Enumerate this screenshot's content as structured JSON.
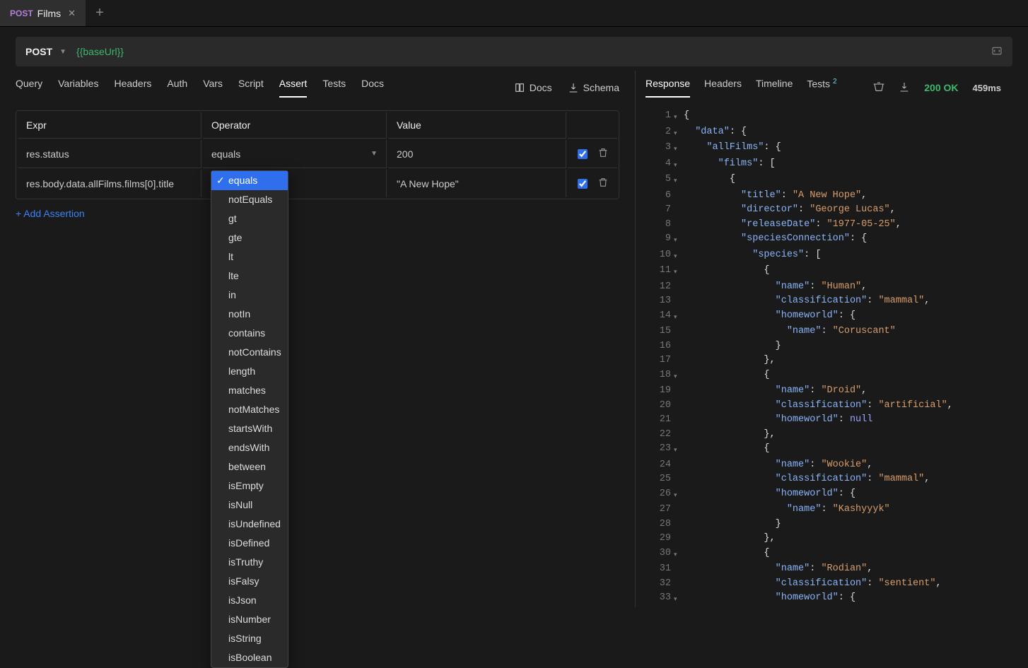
{
  "tab": {
    "method": "POST",
    "title": "Films"
  },
  "request": {
    "method": "POST",
    "url": "{{baseUrl}}"
  },
  "left_tabs": [
    "Query",
    "Variables",
    "Headers",
    "Auth",
    "Vars",
    "Script",
    "Assert",
    "Tests",
    "Docs"
  ],
  "left_tabs_active": "Assert",
  "left_right_links": {
    "docs": "Docs",
    "schema": "Schema"
  },
  "cols": {
    "expr": "Expr",
    "operator": "Operator",
    "value": "Value"
  },
  "assertions": [
    {
      "expr": "res.status",
      "operator": "equals",
      "value": "200",
      "enabled": true
    },
    {
      "expr": "res.body.data.allFilms.films[0].title",
      "operator": "equals",
      "value": "\"A New Hope\"",
      "enabled": true
    }
  ],
  "operator_options": [
    "equals",
    "notEquals",
    "gt",
    "gte",
    "lt",
    "lte",
    "in",
    "notIn",
    "contains",
    "notContains",
    "length",
    "matches",
    "notMatches",
    "startsWith",
    "endsWith",
    "between",
    "isEmpty",
    "isNull",
    "isUndefined",
    "isDefined",
    "isTruthy",
    "isFalsy",
    "isJson",
    "isNumber",
    "isString",
    "isBoolean"
  ],
  "operator_selected": "equals",
  "add_assertion_label": "+ Add Assertion",
  "resp_tabs": {
    "response": "Response",
    "headers": "Headers",
    "timeline": "Timeline",
    "tests": "Tests",
    "tests_count": "2"
  },
  "resp_tabs_active": "Response",
  "status": {
    "code": "200 OK",
    "time": "459ms",
    "size": ""
  },
  "json_lines": [
    {
      "n": 1,
      "f": true,
      "tokens": [
        [
          "brace",
          "{"
        ]
      ]
    },
    {
      "n": 2,
      "f": true,
      "tokens": [
        [
          "sp",
          "  "
        ],
        [
          "key",
          "\"data\""
        ],
        [
          "brace",
          ": {"
        ]
      ]
    },
    {
      "n": 3,
      "f": true,
      "tokens": [
        [
          "sp",
          "    "
        ],
        [
          "key",
          "\"allFilms\""
        ],
        [
          "brace",
          ": {"
        ]
      ]
    },
    {
      "n": 4,
      "f": true,
      "tokens": [
        [
          "sp",
          "      "
        ],
        [
          "key",
          "\"films\""
        ],
        [
          "brace",
          ": ["
        ]
      ]
    },
    {
      "n": 5,
      "f": true,
      "tokens": [
        [
          "sp",
          "        "
        ],
        [
          "brace",
          "{"
        ]
      ]
    },
    {
      "n": 6,
      "f": false,
      "tokens": [
        [
          "sp",
          "          "
        ],
        [
          "key",
          "\"title\""
        ],
        [
          "brace",
          ": "
        ],
        [
          "str",
          "\"A New Hope\""
        ],
        [
          "brace",
          ","
        ]
      ]
    },
    {
      "n": 7,
      "f": false,
      "tokens": [
        [
          "sp",
          "          "
        ],
        [
          "key",
          "\"director\""
        ],
        [
          "brace",
          ": "
        ],
        [
          "str",
          "\"George Lucas\""
        ],
        [
          "brace",
          ","
        ]
      ]
    },
    {
      "n": 8,
      "f": false,
      "tokens": [
        [
          "sp",
          "          "
        ],
        [
          "key",
          "\"releaseDate\""
        ],
        [
          "brace",
          ": "
        ],
        [
          "str",
          "\"1977-05-25\""
        ],
        [
          "brace",
          ","
        ]
      ]
    },
    {
      "n": 9,
      "f": true,
      "tokens": [
        [
          "sp",
          "          "
        ],
        [
          "key",
          "\"speciesConnection\""
        ],
        [
          "brace",
          ": {"
        ]
      ]
    },
    {
      "n": 10,
      "f": true,
      "tokens": [
        [
          "sp",
          "            "
        ],
        [
          "key",
          "\"species\""
        ],
        [
          "brace",
          ": ["
        ]
      ]
    },
    {
      "n": 11,
      "f": true,
      "tokens": [
        [
          "sp",
          "              "
        ],
        [
          "brace",
          "{"
        ]
      ]
    },
    {
      "n": 12,
      "f": false,
      "tokens": [
        [
          "sp",
          "                "
        ],
        [
          "key",
          "\"name\""
        ],
        [
          "brace",
          ": "
        ],
        [
          "str",
          "\"Human\""
        ],
        [
          "brace",
          ","
        ]
      ]
    },
    {
      "n": 13,
      "f": false,
      "tokens": [
        [
          "sp",
          "                "
        ],
        [
          "key",
          "\"classification\""
        ],
        [
          "brace",
          ": "
        ],
        [
          "str",
          "\"mammal\""
        ],
        [
          "brace",
          ","
        ]
      ]
    },
    {
      "n": 14,
      "f": true,
      "tokens": [
        [
          "sp",
          "              "
        ],
        [
          "sp",
          "  "
        ],
        [
          "key",
          "\"homeworld\""
        ],
        [
          "brace",
          ": {"
        ]
      ]
    },
    {
      "n": 15,
      "f": false,
      "tokens": [
        [
          "sp",
          "                  "
        ],
        [
          "key",
          "\"name\""
        ],
        [
          "brace",
          ": "
        ],
        [
          "str",
          "\"Coruscant\""
        ]
      ]
    },
    {
      "n": 16,
      "f": false,
      "tokens": [
        [
          "sp",
          "                "
        ],
        [
          "brace",
          "}"
        ]
      ]
    },
    {
      "n": 17,
      "f": false,
      "tokens": [
        [
          "sp",
          "              "
        ],
        [
          "brace",
          "},"
        ]
      ]
    },
    {
      "n": 18,
      "f": true,
      "tokens": [
        [
          "sp",
          "              "
        ],
        [
          "brace",
          "{"
        ]
      ]
    },
    {
      "n": 19,
      "f": false,
      "tokens": [
        [
          "sp",
          "                "
        ],
        [
          "key",
          "\"name\""
        ],
        [
          "brace",
          ": "
        ],
        [
          "str",
          "\"Droid\""
        ],
        [
          "brace",
          ","
        ]
      ]
    },
    {
      "n": 20,
      "f": false,
      "tokens": [
        [
          "sp",
          "                "
        ],
        [
          "key",
          "\"classification\""
        ],
        [
          "brace",
          ": "
        ],
        [
          "str",
          "\"artificial\""
        ],
        [
          "brace",
          ","
        ]
      ]
    },
    {
      "n": 21,
      "f": false,
      "tokens": [
        [
          "sp",
          "                "
        ],
        [
          "key",
          "\"homeworld\""
        ],
        [
          "brace",
          ": "
        ],
        [
          "null",
          "null"
        ]
      ]
    },
    {
      "n": 22,
      "f": false,
      "tokens": [
        [
          "sp",
          "              "
        ],
        [
          "brace",
          "},"
        ]
      ]
    },
    {
      "n": 23,
      "f": true,
      "tokens": [
        [
          "sp",
          "              "
        ],
        [
          "brace",
          "{"
        ]
      ]
    },
    {
      "n": 24,
      "f": false,
      "tokens": [
        [
          "sp",
          "                "
        ],
        [
          "key",
          "\"name\""
        ],
        [
          "brace",
          ": "
        ],
        [
          "str",
          "\"Wookie\""
        ],
        [
          "brace",
          ","
        ]
      ]
    },
    {
      "n": 25,
      "f": false,
      "tokens": [
        [
          "sp",
          "                "
        ],
        [
          "key",
          "\"classification\""
        ],
        [
          "brace",
          ": "
        ],
        [
          "str",
          "\"mammal\""
        ],
        [
          "brace",
          ","
        ]
      ]
    },
    {
      "n": 26,
      "f": true,
      "tokens": [
        [
          "sp",
          "              "
        ],
        [
          "sp",
          "  "
        ],
        [
          "key",
          "\"homeworld\""
        ],
        [
          "brace",
          ": {"
        ]
      ]
    },
    {
      "n": 27,
      "f": false,
      "tokens": [
        [
          "sp",
          "                  "
        ],
        [
          "key",
          "\"name\""
        ],
        [
          "brace",
          ": "
        ],
        [
          "str",
          "\"Kashyyyk\""
        ]
      ]
    },
    {
      "n": 28,
      "f": false,
      "tokens": [
        [
          "sp",
          "                "
        ],
        [
          "brace",
          "}"
        ]
      ]
    },
    {
      "n": 29,
      "f": false,
      "tokens": [
        [
          "sp",
          "              "
        ],
        [
          "brace",
          "},"
        ]
      ]
    },
    {
      "n": 30,
      "f": true,
      "tokens": [
        [
          "sp",
          "              "
        ],
        [
          "brace",
          "{"
        ]
      ]
    },
    {
      "n": 31,
      "f": false,
      "tokens": [
        [
          "sp",
          "                "
        ],
        [
          "key",
          "\"name\""
        ],
        [
          "brace",
          ": "
        ],
        [
          "str",
          "\"Rodian\""
        ],
        [
          "brace",
          ","
        ]
      ]
    },
    {
      "n": 32,
      "f": false,
      "tokens": [
        [
          "sp",
          "                "
        ],
        [
          "key",
          "\"classification\""
        ],
        [
          "brace",
          ": "
        ],
        [
          "str",
          "\"sentient\""
        ],
        [
          "brace",
          ","
        ]
      ]
    },
    {
      "n": 33,
      "f": true,
      "tokens": [
        [
          "sp",
          "              "
        ],
        [
          "sp",
          "  "
        ],
        [
          "key",
          "\"homeworld\""
        ],
        [
          "brace",
          ": {"
        ]
      ]
    }
  ]
}
